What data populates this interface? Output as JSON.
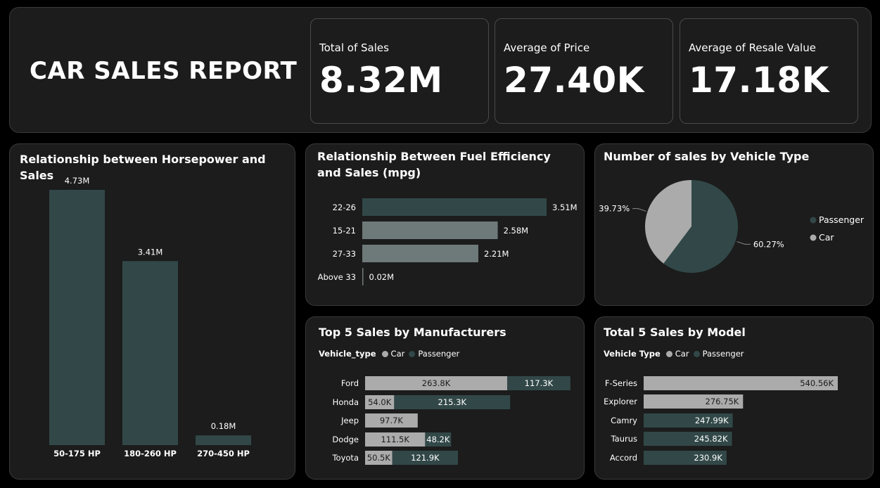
{
  "title": "CAR SALES REPORT",
  "colors": {
    "dark": "#324848",
    "light": "#ababab",
    "mid": "#6e7979"
  },
  "kpis": [
    {
      "label": "Total of Sales",
      "value": "8.32M"
    },
    {
      "label": "Average of Price",
      "value": "27.40K"
    },
    {
      "label": "Average of Resale Value",
      "value": "17.18K"
    }
  ],
  "chart_data": [
    {
      "type": "bar",
      "title": "Relationship between Horsepower and Sales",
      "categories": [
        "50-175 HP",
        "180-260 HP",
        "270-450 HP"
      ],
      "values": [
        4.73,
        3.41,
        0.18
      ],
      "labels": [
        "4.73M",
        "3.41M",
        "0.18M"
      ]
    },
    {
      "type": "bar",
      "orientation": "horizontal",
      "title": "Relationship Between Fuel Efficiency and Sales (mpg)",
      "categories": [
        "22-26",
        "15-21",
        "27-33",
        "Above 33"
      ],
      "values": [
        3.51,
        2.58,
        2.21,
        0.02
      ],
      "labels": [
        "3.51M",
        "2.58M",
        "2.21M",
        "0.02M"
      ]
    },
    {
      "type": "pie",
      "title": "Number of sales by Vehicle Type",
      "categories": [
        "Passenger",
        "Car"
      ],
      "values": [
        60.27,
        39.73
      ],
      "labels": [
        "60.27%",
        "39.73%"
      ],
      "legend": "right"
    },
    {
      "type": "bar",
      "orientation": "horizontal",
      "stacked": true,
      "title": "Top 5 Sales by Manufacturers",
      "legend_title": "Vehicle_type",
      "categories": [
        "Ford",
        "Honda",
        "Jeep",
        "Dodge",
        "Toyota"
      ],
      "series": [
        {
          "name": "Car",
          "values": [
            263.8,
            54.0,
            97.7,
            111.5,
            50.5
          ],
          "labels": [
            "263.8K",
            "54.0K",
            "97.7K",
            "111.5K",
            "50.5K"
          ]
        },
        {
          "name": "Passenger",
          "values": [
            117.3,
            215.3,
            0,
            48.2,
            121.9
          ],
          "labels": [
            "117.3K",
            "215.3K",
            "",
            "48.2K",
            "121.9K"
          ]
        }
      ]
    },
    {
      "type": "bar",
      "orientation": "horizontal",
      "title": "Total 5 Sales by Model",
      "legend_title": "Vehicle Type",
      "legend": [
        "Car",
        "Passenger"
      ],
      "categories": [
        "F-Series",
        "Explorer",
        "Camry",
        "Taurus",
        "Accord"
      ],
      "values": [
        540.56,
        276.75,
        247.99,
        245.82,
        230.9
      ],
      "labels": [
        "540.56K",
        "276.75K",
        "247.99K",
        "245.82K",
        "230.9K"
      ],
      "series_of": [
        "Car",
        "Car",
        "Passenger",
        "Passenger",
        "Passenger"
      ]
    }
  ]
}
